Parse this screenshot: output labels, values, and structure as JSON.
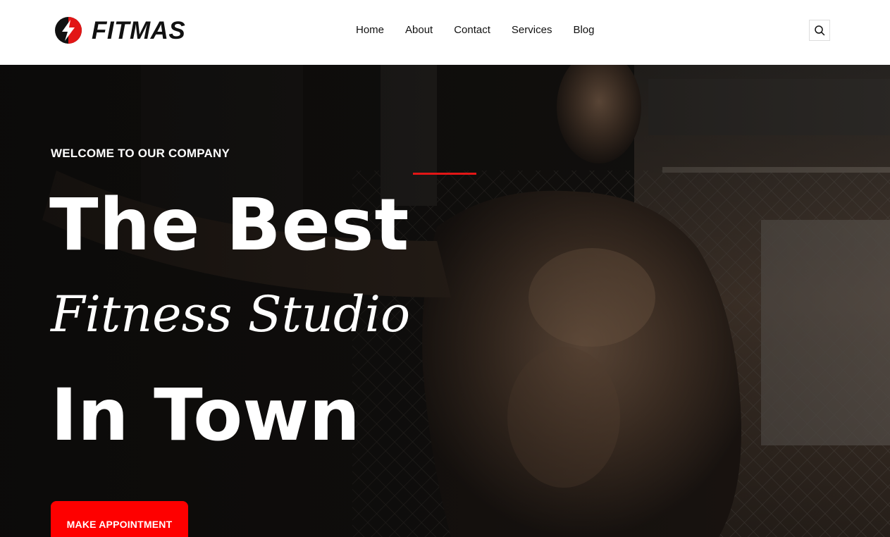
{
  "brand": {
    "name": "FITMAS",
    "accent_color": "#e21616"
  },
  "nav": {
    "items": [
      {
        "label": "Home"
      },
      {
        "label": "About"
      },
      {
        "label": "Contact"
      },
      {
        "label": "Services"
      },
      {
        "label": "Blog"
      }
    ],
    "search_icon": "search-icon"
  },
  "hero": {
    "eyebrow": "WELCOME TO OUR COMPANY",
    "title_line1": "The Best",
    "title_line2": "Fitness Studio",
    "title_line3": "In Town",
    "cta_label": "MAKE APPOINTMENT",
    "cta_color": "#fe0000"
  }
}
